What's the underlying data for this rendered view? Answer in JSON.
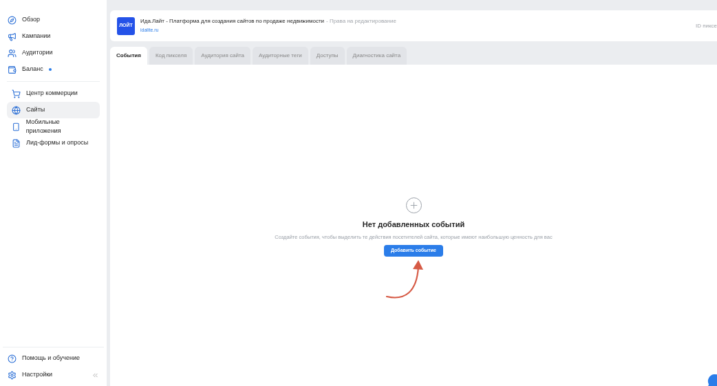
{
  "sidebar": {
    "groups": [
      [
        {
          "label": "Обзор",
          "selected": false,
          "dot": false
        },
        {
          "label": "Кампании",
          "selected": false,
          "dot": false
        },
        {
          "label": "Аудитории",
          "selected": false,
          "dot": false
        },
        {
          "label": "Баланс",
          "selected": false,
          "dot": true
        }
      ],
      [
        {
          "label": "Центр коммерции",
          "selected": false,
          "dot": false
        },
        {
          "label": "Сайты",
          "selected": true,
          "dot": false
        },
        {
          "label": "Мобильные приложения",
          "selected": false,
          "dot": false
        },
        {
          "label": "Лид-формы и опросы",
          "selected": false,
          "dot": false
        }
      ]
    ],
    "footer": [
      {
        "label": "Помощь и обучение"
      },
      {
        "label": "Настройки"
      }
    ]
  },
  "site": {
    "logo": "ЛОЙТ",
    "title": "Ида.Лайт - Платформа для создания сайтов по продаже недвижимости",
    "rights": "- Права на редактирование",
    "url": "idalite.ru",
    "pixel_id": "ID пиксе"
  },
  "tabs": [
    {
      "label": "События",
      "selected": true
    },
    {
      "label": "Код пикселя",
      "selected": false
    },
    {
      "label": "Аудитория сайта",
      "selected": false
    },
    {
      "label": "Аудиторные теги",
      "selected": false
    },
    {
      "label": "Доступы",
      "selected": false
    },
    {
      "label": "Диагностика сайта",
      "selected": false
    }
  ],
  "empty": {
    "title": "Нет добавленных событий",
    "text": "Создайте события, чтобы выделить те действия посетителей сайта, которые имеют наибольшую ценность для вас",
    "button": "Добавить событие"
  }
}
